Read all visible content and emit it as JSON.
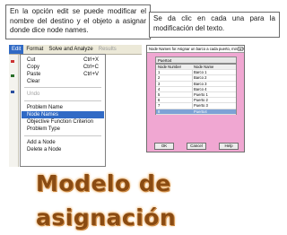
{
  "callouts": {
    "left": "En la opción edit se puede modificar el nombre del destino y el objeto a asignar donde dice node names.",
    "right": "Se da clic en cada una para la modificación del texto."
  },
  "menubar": {
    "items": [
      "Edit",
      "Format",
      "Solve and Analyze",
      "Results"
    ]
  },
  "edit_menu": {
    "items": [
      {
        "label": "Cut",
        "shortcut": "Ctrl+X",
        "disabled": false
      },
      {
        "label": "Copy",
        "shortcut": "Ctrl+C",
        "disabled": false
      },
      {
        "label": "Paste",
        "shortcut": "Ctrl+V",
        "disabled": false
      },
      {
        "label": "Clear",
        "shortcut": "",
        "disabled": false
      },
      {
        "label": "Undo",
        "shortcut": "",
        "disabled": true
      },
      {
        "label": "Problem Name",
        "shortcut": "",
        "disabled": false
      },
      {
        "label": "Node Names",
        "shortcut": "",
        "disabled": false,
        "highlighted": true
      },
      {
        "label": "Objective Function Criterion",
        "shortcut": "",
        "disabled": false
      },
      {
        "label": "Problem Type",
        "shortcut": "",
        "disabled": false
      },
      {
        "label": "Add a Node",
        "shortcut": "",
        "disabled": false
      },
      {
        "label": "Delete a Node",
        "shortcut": "",
        "disabled": false
      }
    ]
  },
  "dialog": {
    "title": "Node Names for Asignar un barco a cada puerto, minimiza",
    "close": "x",
    "top_field": "Puerto4",
    "columns": [
      "Node Number",
      "Node Name"
    ],
    "rows": [
      [
        "1",
        "Barco 1"
      ],
      [
        "2",
        "Barco 2"
      ],
      [
        "3",
        "Barco 3"
      ],
      [
        "4",
        "Barco 4"
      ],
      [
        "5",
        "Puerto 1"
      ],
      [
        "6",
        "Puerto 2"
      ],
      [
        "7",
        "Puerto 3"
      ],
      [
        "8",
        "Puerto4"
      ]
    ],
    "selected_row": 7,
    "buttons": [
      "OK",
      "Cancel",
      "Help"
    ]
  },
  "slide_title": "Modelo de asignación",
  "colors": {
    "dialog_bg": "#f0a7d2",
    "highlight": "#316ac5",
    "title_color": "#8a4b12"
  }
}
